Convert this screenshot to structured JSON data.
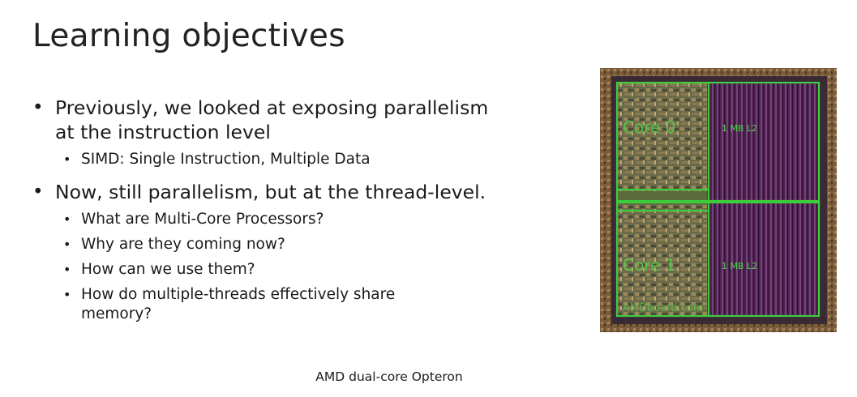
{
  "slide": {
    "title": "Learning objectives",
    "bullets": [
      {
        "text": "Previously, we looked at exposing parallelism at the instruction level",
        "line1": "Previously, we looked at exposing parallelism",
        "line2": "at the instruction level",
        "sub": [
          "SIMD: Single Instruction, Multiple Data"
        ]
      },
      {
        "text": "Now, still parallelism, but at the thread-level.",
        "sub": [
          "What are Multi-Core Processors?",
          "Why are they coming now?",
          "How can we use them?",
          "How do multiple-threads effectively share memory?"
        ],
        "sub4_line1": "How do multiple-threads effectively share",
        "sub4_line2": "memory?"
      }
    ],
    "image": {
      "caption": "AMD dual-core Opteron",
      "labels": {
        "core0": "Core 0",
        "core1": "Core 1",
        "l2_top": "1 MB L2",
        "l2_bottom": "1 MB L2",
        "watermark": "AMDboard.com"
      },
      "colors": {
        "outline": "#3ccc3c",
        "cache_stripe": "#5a2a5e",
        "frame": "#8a6a3a"
      }
    }
  }
}
